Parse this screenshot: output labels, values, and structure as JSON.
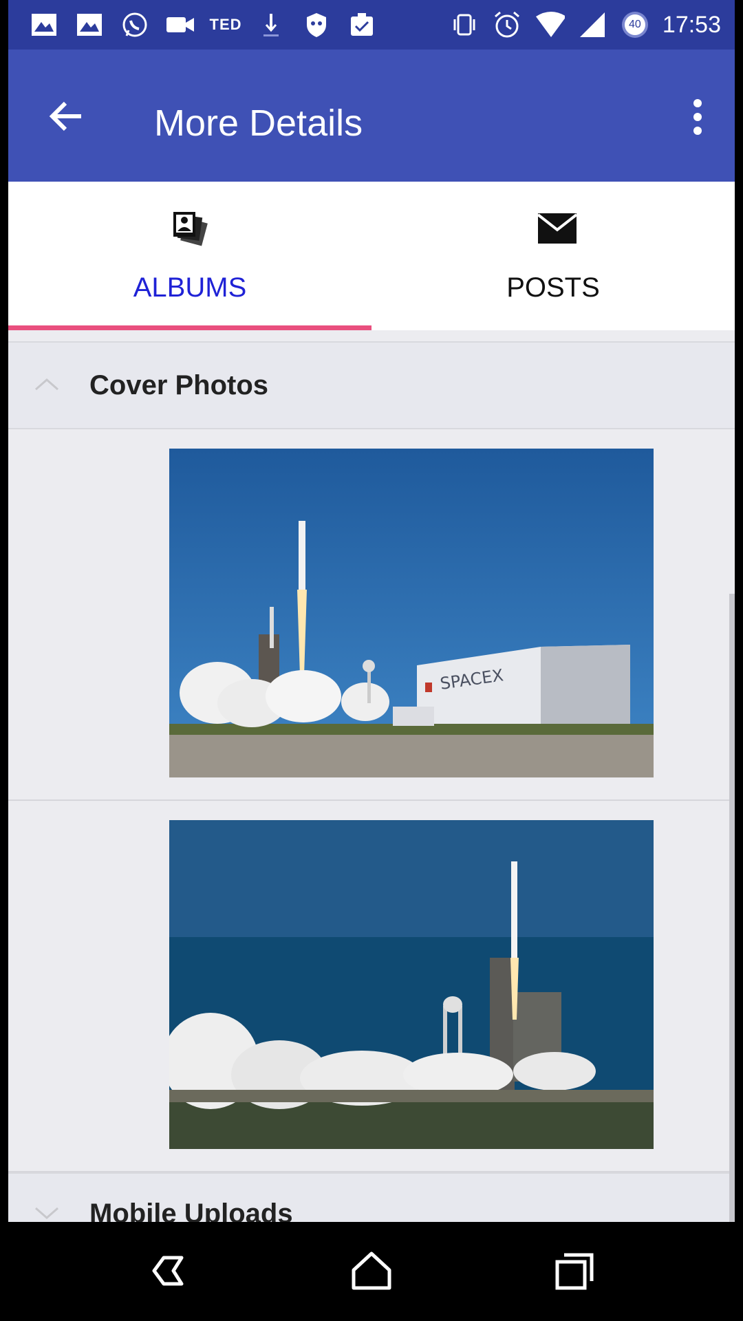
{
  "status_bar": {
    "time": "17:53",
    "battery_level": "40",
    "icons_left": [
      "photo-icon",
      "photo-icon",
      "whatsapp-icon",
      "video-icon",
      "ted-icon",
      "download-icon",
      "shield-icon",
      "clipboard-icon"
    ],
    "ted_label": "TED",
    "icons_right": [
      "vibrate-icon",
      "alarm-icon",
      "wifi-icon",
      "signal-icon",
      "battery-icon"
    ]
  },
  "app_bar": {
    "title": "More Details",
    "back_icon": "arrow-back-icon",
    "menu_icon": "more-vert-icon",
    "color": "#3f51b5"
  },
  "tabs": [
    {
      "label": "ALBUMS",
      "icon": "photo-album-icon",
      "selected": true
    },
    {
      "label": "POSTS",
      "icon": "mail-icon",
      "selected": false
    }
  ],
  "tab_indicator_color": "#e94f7e",
  "albums": [
    {
      "title": "Cover Photos",
      "expanded": true,
      "photos": [
        "rocket-launch-photo-spacex-hangar",
        "rocket-launch-photo-ocean"
      ]
    },
    {
      "title": "Mobile Uploads",
      "expanded": false
    }
  ],
  "nav_bar": {
    "buttons": [
      "back-icon",
      "home-icon",
      "recents-icon"
    ]
  }
}
